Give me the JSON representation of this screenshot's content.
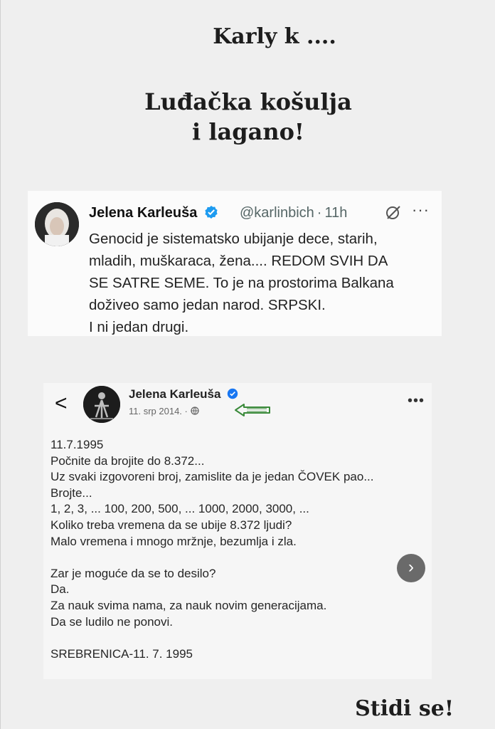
{
  "captions": {
    "top": "Karly k ....",
    "middle_line1": "Luđačka košulja",
    "middle_line2": "i lagano!",
    "bottom": "Stidi se!"
  },
  "tweet": {
    "author_name": "Jelena Karleuša",
    "handle": "@karlinbich",
    "time": "11h",
    "separator": "·",
    "more": "···",
    "text": "Genocid je sistematsko ubijanje dece, starih,\nmladih, muškaraca, žena.... REDOM SVIH DA\nSE SATRE SEME. To je na prostorima Balkana\ndoživeo samo jedan narod. SRPSKI.\n I ni jedan drugi.",
    "icons": [
      "verified-badge-icon",
      "grok-icon",
      "more-icon"
    ]
  },
  "facebook_post": {
    "back": "<",
    "author_name": "Jelena Karleuša",
    "date": "11. srp 2014. ·",
    "more": "•••",
    "next": "›",
    "text": "11.7.1995\nPočnite da brojite do 8.372...\nUz svaki izgovoreni broj, zamislite da je jedan ČOVEK pao...\nBrojte...\n1, 2, 3, ... 100, 200, 500, ... 1000, 2000, 3000, ...\nKoliko treba vremena da se ubije 8.372 ljudi?\nMalo vremena i mnogo mržnje, bezumlja i zla.\n\nZar je moguće da se to desilo?\nDa.\nZa nauk svima nama, za nauk novim generacijama.\nDa se ludilo ne ponovi.\n\nSREBRENICA-11. 7. 1995",
    "icons": [
      "back-chevron-icon",
      "verified-badge-icon",
      "globe-icon",
      "green-arrow-icon",
      "next-arrow-icon"
    ]
  },
  "colors": {
    "background": "#efefef",
    "verified_blue": "#1d9bf0",
    "arrow_green": "#3a8a3a"
  }
}
